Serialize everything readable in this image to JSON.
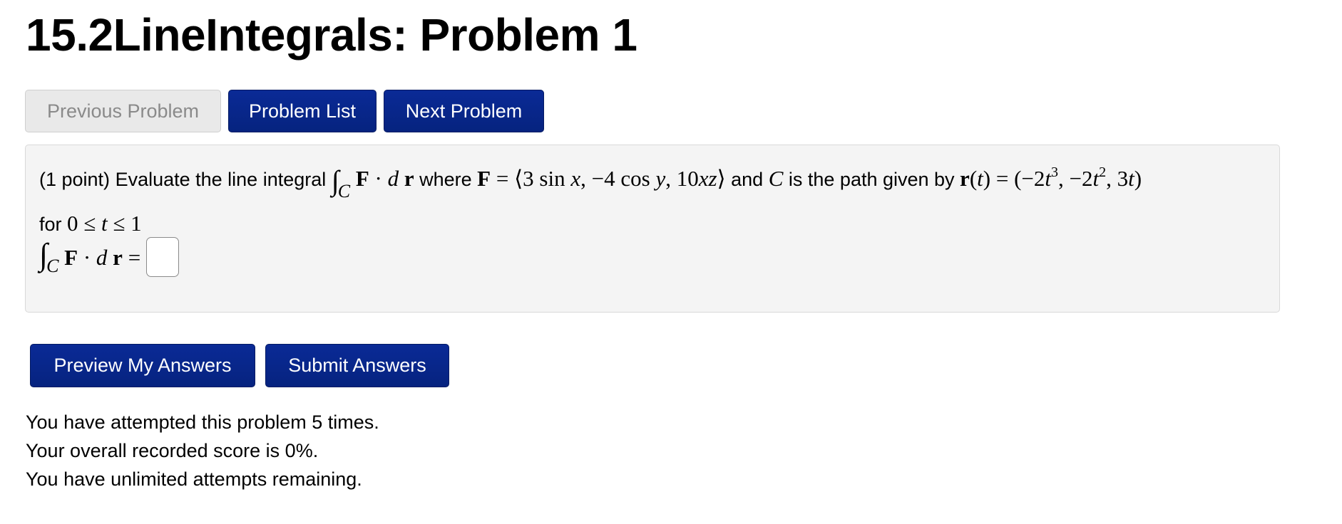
{
  "page": {
    "title": "15.2LineIntegrals: Problem 1"
  },
  "nav": {
    "previous_label": "Previous Problem",
    "list_label": "Problem List",
    "next_label": "Next Problem"
  },
  "problem": {
    "points": "(1 point)",
    "text_1": " Evaluate the line integral ",
    "text_2": " where ",
    "text_3": " and ",
    "text_4": " is the path given by ",
    "text_5": "for ",
    "answer_value": ""
  },
  "actions": {
    "preview_label": "Preview My Answers",
    "submit_label": "Submit Answers"
  },
  "status": {
    "attempts": "You have attempted this problem 5 times.",
    "score": "Your overall recorded score is 0%.",
    "remaining": "You have unlimited attempts remaining."
  },
  "colors": {
    "primary_button": "#06237f",
    "disabled_button": "#e9e9e9",
    "problem_background": "#f4f4f4"
  }
}
